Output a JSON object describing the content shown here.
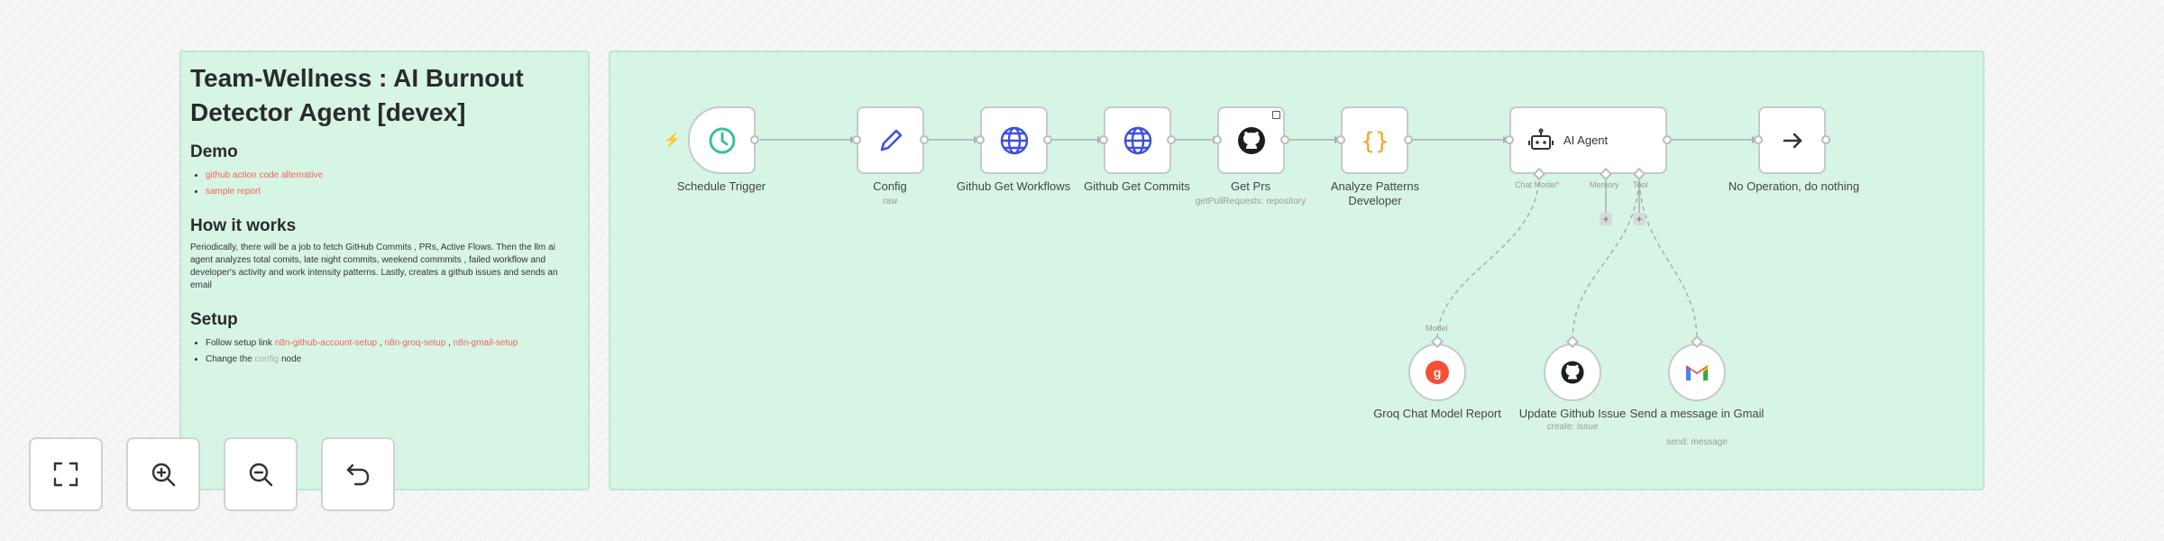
{
  "sticky_note": {
    "title": "Team-Wellness : AI Burnout Detector Agent [devex]",
    "demo": {
      "heading": "Demo",
      "links": [
        "github action code alternative",
        "sample report"
      ]
    },
    "how": {
      "heading": "How it works",
      "body": "Periodically, there will be a job to fetch GitHub Commits , PRs, Active Flows. Then the llm ai agent analyzes total comits, late night commits, weekend commmits , failed workflow and developer's activity and work intensity patterns. Lastly, creates a github issues and sends an email"
    },
    "setup": {
      "heading": "Setup",
      "line1_prefix": "Follow setup link",
      "line1_links": [
        "n8n-github-account-setup",
        "n8n-groq-setup",
        "n8n-gmail-setup"
      ],
      "line2_prefix": "Change the",
      "line2_code": "config",
      "line2_suffix": "node"
    }
  },
  "nodes": {
    "schedule_trigger": {
      "label": "Schedule Trigger",
      "icon": "clock-icon"
    },
    "config": {
      "label": "Config",
      "subtitle": "raw",
      "icon": "pencil-icon"
    },
    "github_get_workflows": {
      "label": "Github Get Workflows",
      "icon": "globe-icon"
    },
    "github_get_commits": {
      "label": "Github Get Commits",
      "icon": "globe-icon"
    },
    "get_prs": {
      "label": "Get Prs",
      "subtitle": "getPullRequests: repository",
      "icon": "github-icon"
    },
    "analyze_patterns": {
      "label": "Analyze Patterns Developer",
      "icon": "braces-icon"
    },
    "ai_agent": {
      "label": "AI Agent",
      "icon": "robot-icon",
      "ports": {
        "chat_model": "Chat Model*",
        "memory": "Memory",
        "tool": "Tool"
      }
    },
    "no_operation": {
      "label": "No Operation, do nothing",
      "icon": "arrow-right-icon"
    },
    "groq_chat_model": {
      "label": "Groq Chat Model Report",
      "port_label": "Model",
      "icon": "groq-icon"
    },
    "update_github_issue": {
      "label": "Update Github Issue",
      "subtitle": "create: issue",
      "icon": "github-icon"
    },
    "gmail": {
      "label": "Send a message in Gmail",
      "subtitle": "send: message",
      "icon": "gmail-icon"
    }
  },
  "controls": {
    "fit_view": "fit-view-icon",
    "zoom_in": "zoom-in-icon",
    "zoom_out": "zoom-out-icon",
    "undo": "undo-icon"
  },
  "colors": {
    "sticky_bg": "#d7f5e4",
    "link_red": "#f0635a",
    "clock_teal": "#3bbfa0",
    "globe_blue": "#3c4fe0",
    "braces_orange": "#f5a623",
    "groq_red": "#f55036"
  }
}
